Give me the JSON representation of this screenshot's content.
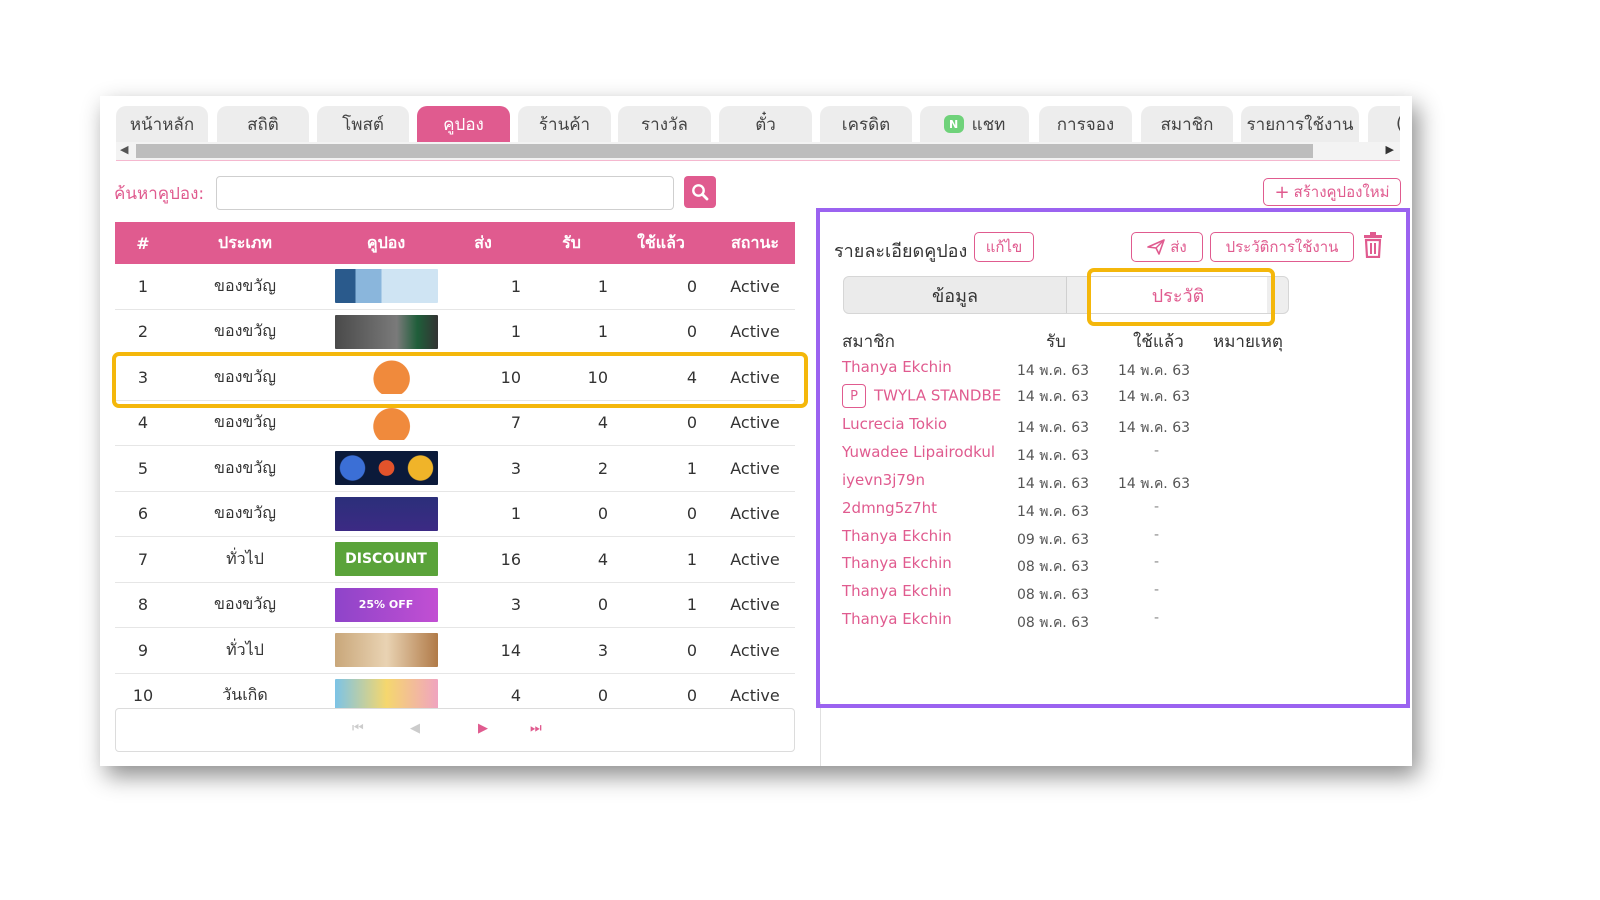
{
  "tabs": [
    {
      "label": "หน้าหลัก"
    },
    {
      "label": "สถิติ"
    },
    {
      "label": "โพสต์"
    },
    {
      "label": "คูปอง",
      "active": true
    },
    {
      "label": "ร้านค้า"
    },
    {
      "label": "รางวัล"
    },
    {
      "label": "ตั๋ว"
    },
    {
      "label": "เครดิต"
    },
    {
      "label": "แชท",
      "icon": "line-chat-icon"
    },
    {
      "label": "การจอง"
    },
    {
      "label": "สมาชิก"
    },
    {
      "label": "รายการใช้งาน"
    }
  ],
  "search": {
    "label": "ค้นหาคูปอง:",
    "value": ""
  },
  "create_button": "สร้างคูปองใหม่",
  "table": {
    "headers": {
      "num": "#",
      "type": "ประเภท",
      "coupon": "คูปอง",
      "send": "ส่ง",
      "recv": "รับ",
      "used": "ใช้แล้ว",
      "status": "สถานะ"
    },
    "rows": [
      {
        "num": "1",
        "type": "ของขวัญ",
        "send": "1",
        "recv": "1",
        "used": "0",
        "status": "Active"
      },
      {
        "num": "2",
        "type": "ของขวัญ",
        "send": "1",
        "recv": "1",
        "used": "0",
        "status": "Active"
      },
      {
        "num": "3",
        "type": "ของขวัญ",
        "send": "10",
        "recv": "10",
        "used": "4",
        "status": "Active"
      },
      {
        "num": "4",
        "type": "ของขวัญ",
        "send": "7",
        "recv": "4",
        "used": "0",
        "status": "Active"
      },
      {
        "num": "5",
        "type": "ของขวัญ",
        "send": "3",
        "recv": "2",
        "used": "1",
        "status": "Active"
      },
      {
        "num": "6",
        "type": "ของขวัญ",
        "send": "1",
        "recv": "0",
        "used": "0",
        "status": "Active"
      },
      {
        "num": "7",
        "type": "ทั่วไป",
        "send": "16",
        "recv": "4",
        "used": "1",
        "status": "Active",
        "img_text": "DISCOUNT"
      },
      {
        "num": "8",
        "type": "ของขวัญ",
        "send": "3",
        "recv": "0",
        "used": "1",
        "status": "Active",
        "img_text": "25% OFF"
      },
      {
        "num": "9",
        "type": "ทั่วไป",
        "send": "14",
        "recv": "3",
        "used": "0",
        "status": "Active"
      },
      {
        "num": "10",
        "type": "วันเกิด",
        "send": "4",
        "recv": "0",
        "used": "0",
        "status": "Active"
      }
    ]
  },
  "detail": {
    "title": "รายละเอียดคูปอง",
    "edit_button": "แก้ไข",
    "send_button": "ส่ง",
    "history_button": "ประวัติการใช้งาน",
    "seg_info": "ข้อมูล",
    "seg_history": "ประวัติ",
    "headers": {
      "member": "สมาชิก",
      "recv": "รับ",
      "used": "ใช้แล้ว",
      "note": "หมายเหตุ"
    },
    "members": [
      {
        "name": "Thanya Ekchin",
        "recv": "14 พ.ค. 63",
        "used": "14 พ.ค. 63"
      },
      {
        "name": "TWYLA STANDBE",
        "badge": "P",
        "recv": "14 พ.ค. 63",
        "used": "14 พ.ค. 63"
      },
      {
        "name": "Lucrecia Tokio",
        "recv": "14 พ.ค. 63",
        "used": "14 พ.ค. 63"
      },
      {
        "name": "Yuwadee Lipairodkul",
        "recv": "14 พ.ค. 63",
        "used": "-"
      },
      {
        "name": "iyevn3j79n",
        "recv": "14 พ.ค. 63",
        "used": "14 พ.ค. 63"
      },
      {
        "name": "2dmng5z7ht",
        "recv": "14 พ.ค. 63",
        "used": "-"
      },
      {
        "name": "Thanya Ekchin",
        "recv": "09 พ.ค. 63",
        "used": "-"
      },
      {
        "name": "Thanya Ekchin",
        "recv": "08 พ.ค. 63",
        "used": "-"
      },
      {
        "name": "Thanya Ekchin",
        "recv": "08 พ.ค. 63",
        "used": "-"
      },
      {
        "name": "Thanya Ekchin",
        "recv": "08 พ.ค. 63",
        "used": "-"
      }
    ]
  },
  "colors": {
    "accent": "#e05b8f",
    "highlight_yellow": "#f4b70b",
    "highlight_purple": "#9b63f0"
  }
}
